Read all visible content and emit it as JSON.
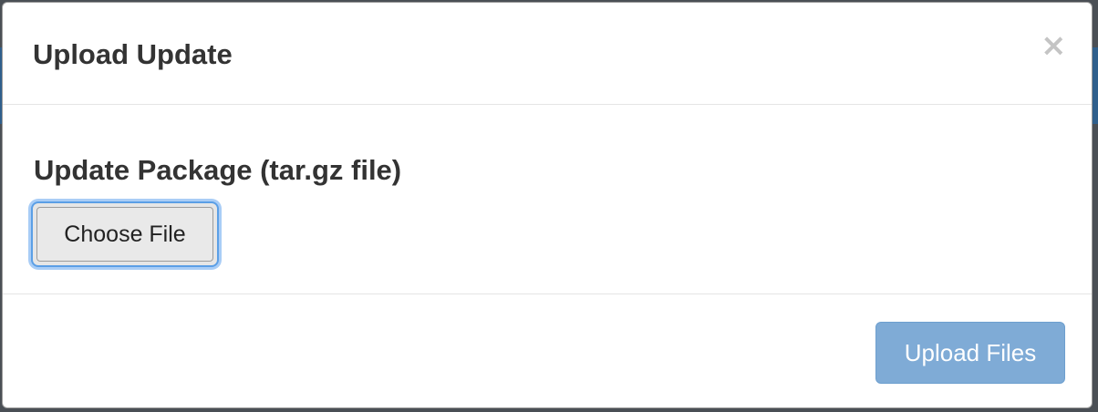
{
  "modal": {
    "title": "Upload Update",
    "close_symbol": "×",
    "close_icon": "close-icon"
  },
  "form": {
    "field_label": "Update Package (tar.gz file)",
    "file_button_label": "Choose File"
  },
  "footer": {
    "upload_button_label": "Upload Files",
    "upload_button_state": "disabled"
  },
  "colors": {
    "primary_disabled": "#7fabd6",
    "focus_ring": "#5b9fe6",
    "text": "#333333",
    "close_icon": "#c4c4c4"
  }
}
